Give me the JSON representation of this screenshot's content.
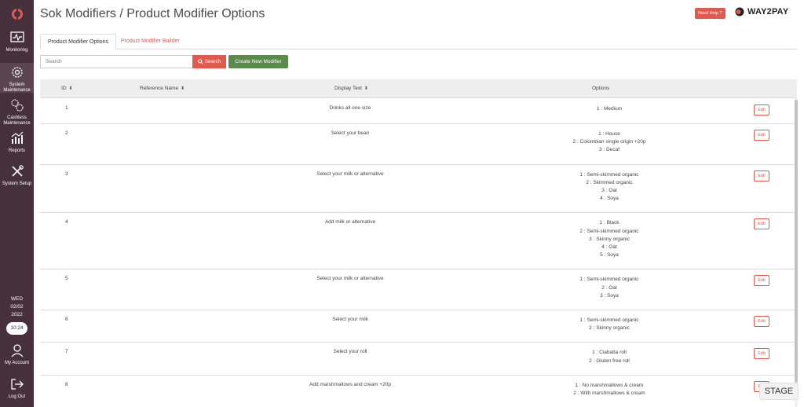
{
  "sidebar": {
    "items": [
      {
        "label": "Monitoring",
        "icon": "monitoring-icon"
      },
      {
        "label": "System Maintenance",
        "icon": "gear-icon"
      },
      {
        "label": "Cashless Maintenance",
        "icon": "cogs-icon"
      },
      {
        "label": "Reports",
        "icon": "chart-icon"
      },
      {
        "label": "System Setup",
        "icon": "tools-icon"
      }
    ],
    "date": {
      "day": "WED",
      "date": "02/02",
      "year": "2022"
    },
    "time": "10:24",
    "account_label": "My Account",
    "logout_label": "Log Out"
  },
  "header": {
    "title": "Sok Modifiers / Product Modifier Options",
    "help_label": "Need Help ?",
    "brand": "WAY2PAY"
  },
  "tabs": [
    {
      "label": "Product Modifier Options",
      "active": true
    },
    {
      "label": "Product Modifier Builder",
      "active": false
    }
  ],
  "search": {
    "placeholder": "Search",
    "button_label": "Search",
    "create_label": "Create New Modifier"
  },
  "table": {
    "headers": {
      "id": "ID",
      "reference": "Reference Name",
      "display": "Display Text",
      "options": "Options"
    },
    "edit_label": "Edit",
    "rows": [
      {
        "id": "1",
        "display": "Drinks all one size",
        "options": [
          "1 : Medium"
        ]
      },
      {
        "id": "2",
        "display": "Select your bean",
        "options": [
          "1 : House",
          "2 : Colombian single origin +20p",
          "3 : Decaf"
        ]
      },
      {
        "id": "3",
        "display": "Select your milk or alternative",
        "options": [
          "1 : Semi-skimmed organic",
          "2 : Skimmed organic",
          "3 : Oat",
          "4 : Soya"
        ]
      },
      {
        "id": "4",
        "display": "Add milk or alternative",
        "options": [
          "1 : Black",
          "2 : Semi-skimmed organic",
          "3 : Skinny organic",
          "4 : Oat",
          "5 : Soya"
        ]
      },
      {
        "id": "5",
        "display": "Select your milk or alternative",
        "options": [
          "1 : Semi-skimmed organic",
          "2 : Oat",
          "3 : Soya"
        ]
      },
      {
        "id": "6",
        "display": "Select your milk",
        "options": [
          "1 : Semi-skimmed organic",
          "2 : Skinny organic"
        ]
      },
      {
        "id": "7",
        "display": "Select your roll",
        "options": [
          "1 : Ciabatta roll",
          "2 : Gluten free roll"
        ]
      },
      {
        "id": "8",
        "display": "Add marshmallows and cream +20p",
        "options": [
          "1 : No marshmallows & cream",
          "2 : With marshmallows & cream"
        ]
      }
    ]
  },
  "environment_badge": "STAGE",
  "colors": {
    "sidebar": "#46303b",
    "accent": "#e05a4f",
    "create": "#5c8a4e"
  }
}
